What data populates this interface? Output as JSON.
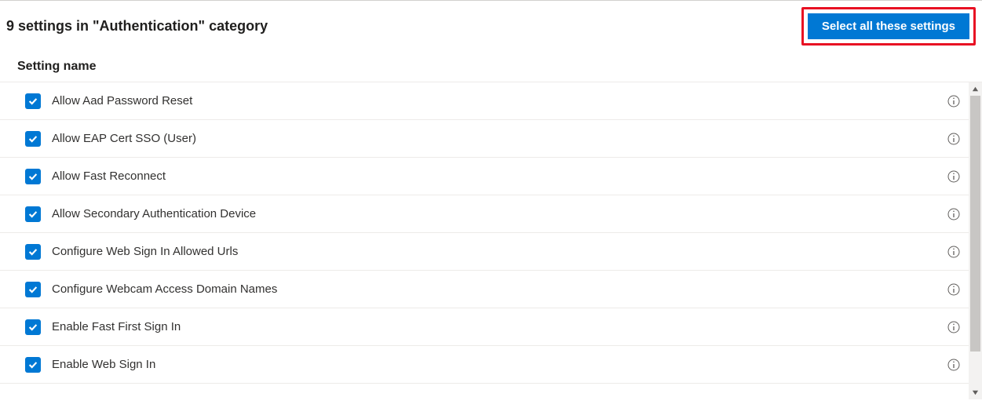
{
  "header": {
    "title": "9 settings in \"Authentication\" category",
    "select_all_label": "Select all these settings"
  },
  "column_header": "Setting name",
  "settings": [
    {
      "label": "Allow Aad Password Reset",
      "checked": true
    },
    {
      "label": "Allow EAP Cert SSO (User)",
      "checked": true
    },
    {
      "label": "Allow Fast Reconnect",
      "checked": true
    },
    {
      "label": "Allow Secondary Authentication Device",
      "checked": true
    },
    {
      "label": "Configure Web Sign In Allowed Urls",
      "checked": true
    },
    {
      "label": "Configure Webcam Access Domain Names",
      "checked": true
    },
    {
      "label": "Enable Fast First Sign In",
      "checked": true
    },
    {
      "label": "Enable Web Sign In",
      "checked": true
    }
  ]
}
